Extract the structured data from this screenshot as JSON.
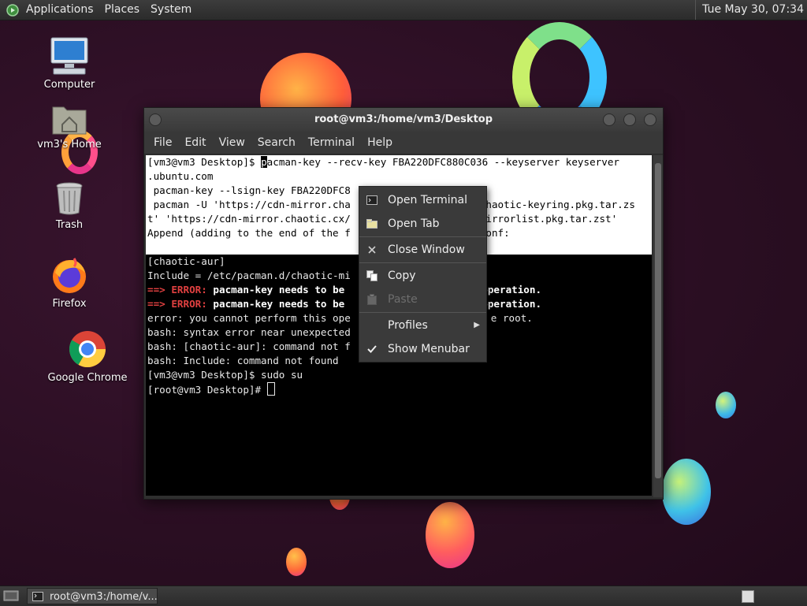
{
  "top_panel": {
    "menus": [
      "Applications",
      "Places",
      "System"
    ],
    "clock": "Tue May 30, 07:34"
  },
  "desktop_icons": [
    {
      "label": "Computer",
      "icon": "computer-icon"
    },
    {
      "label": "vm3's Home",
      "icon": "home-folder-icon"
    },
    {
      "label": "Trash",
      "icon": "trash-icon"
    },
    {
      "label": "Firefox",
      "icon": "firefox-icon"
    },
    {
      "label": "Google Chrome",
      "icon": "chrome-icon"
    }
  ],
  "terminal": {
    "title": "root@vm3:/home/vm3/Desktop",
    "menu": [
      "File",
      "Edit",
      "View",
      "Search",
      "Terminal",
      "Help"
    ],
    "lines": {
      "l1_prompt": "[vm3@vm3 Desktop]$ ",
      "l1_cmd_first": "p",
      "l1_cmd_rest": "acman-key --recv-key FBA220DFC880C036 --keyserver keyserver",
      "l2": ".ubuntu.com",
      "l3": " pacman-key --lsign-key FBA220DFC8",
      "l4a": " pacman -U 'https://cdn-mirror.cha",
      "l4b": "chaotic-keyring.pkg.tar.zs",
      "l5a": "t' 'https://cdn-mirror.chaotic.cx/",
      "l5b": "mirrorlist.pkg.tar.zst'",
      "l6a": "Append (adding to the end of the f",
      "l6b": "conf:",
      "l8": "[chaotic-aur]",
      "l9": "Include = /etc/pacman.d/chaotic-mi",
      "l10_arrow": "==> ",
      "l10_err": "ERROR: ",
      "l10_msg": "pacman-key needs to be",
      "l10_end": "operation.",
      "l11_arrow": "==> ",
      "l11_err": "ERROR: ",
      "l11_msg": "pacman-key needs to be",
      "l11_end": "operation.",
      "l12a": "error: you cannot perform this ope",
      "l12b": "e root.",
      "l13": "bash: syntax error near unexpected",
      "l14": "bash: [chaotic-aur]: command not f",
      "l15": "bash: Include: command not found",
      "l16": "[vm3@vm3 Desktop]$ sudo su",
      "l17": "[root@vm3 Desktop]# "
    }
  },
  "context_menu": {
    "items": [
      {
        "label": "Open Terminal",
        "icon": "terminal-icon",
        "enabled": true
      },
      {
        "label": "Open Tab",
        "icon": "new-tab-icon",
        "enabled": true
      },
      {
        "label": "Close Window",
        "icon": "close-icon",
        "enabled": true
      },
      {
        "label": "Copy",
        "icon": "copy-icon",
        "enabled": true
      },
      {
        "label": "Paste",
        "icon": "paste-icon",
        "enabled": false
      },
      {
        "label": "Profiles",
        "icon": "",
        "enabled": true,
        "submenu": true
      },
      {
        "label": "Show Menubar",
        "icon": "check-icon",
        "enabled": true,
        "checked": true
      }
    ]
  },
  "bottom_panel": {
    "task_label": "root@vm3:/home/v..."
  },
  "colors": {
    "error_red": "#e04040",
    "panel_bg": "#333333",
    "terminal_bg": "#000000"
  }
}
